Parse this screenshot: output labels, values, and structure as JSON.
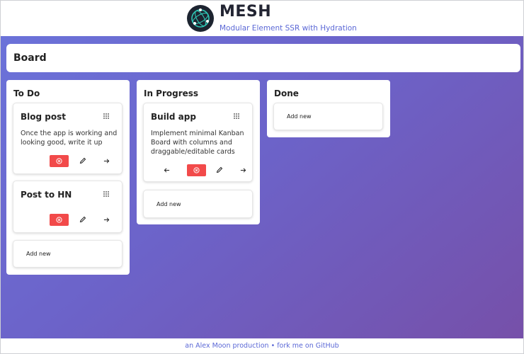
{
  "brand": {
    "title": "MESH",
    "subtitle": "Modular Element SSR with Hydration"
  },
  "board": {
    "title": "Board"
  },
  "columns": [
    {
      "title": "To Do",
      "cards": [
        {
          "title": "Blog post",
          "description": "Once the app is working and looking good, write it up"
        },
        {
          "title": "Post to HN",
          "description": ""
        }
      ],
      "add_new": "Add new"
    },
    {
      "title": "In Progress",
      "cards": [
        {
          "title": "Build app",
          "description": "Implement minimal Kanban Board with columns and draggable/editable cards"
        }
      ],
      "add_new": "Add new"
    },
    {
      "title": "Done",
      "cards": [],
      "add_new": "Add new"
    }
  ],
  "footer": {
    "prefix": "an",
    "author": "Alex Moon",
    "production": "production",
    "separator": "•",
    "fork": "fork me on GitHub"
  },
  "colors": {
    "accent": "#5b68d6",
    "delete": "#f24a4a",
    "gradient_start": "#6b72d9",
    "gradient_end": "#7650a9"
  },
  "icons": [
    "logo-icon",
    "grip-icon",
    "delete-icon",
    "edit-icon",
    "arrow-right-icon",
    "arrow-left-icon"
  ]
}
